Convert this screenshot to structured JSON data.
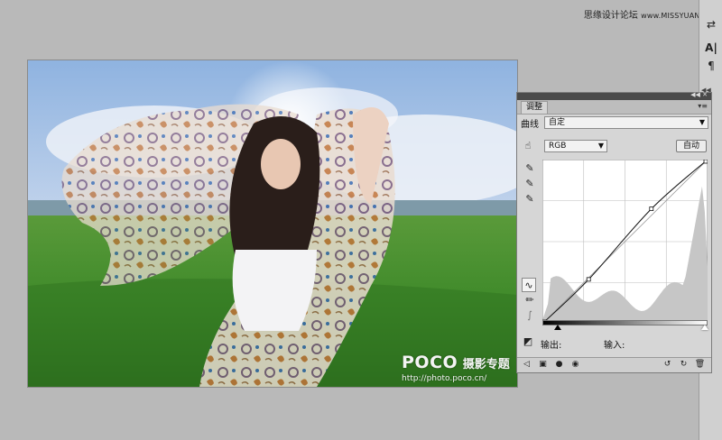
{
  "watermark": {
    "site_name": "思缘设计论坛",
    "site_url": "www.MISSYUAN.com"
  },
  "photo": {
    "brand": "POCO",
    "tagline": "摄影专题",
    "url": "http://photo.poco.cn/"
  },
  "panel": {
    "tab_label": "调整",
    "curves_label": "曲线",
    "preset_value": "自定",
    "channel_value": "RGB",
    "auto_label": "自动",
    "output_label": "输出:",
    "input_label": "输入:"
  },
  "curve": {
    "control_points": [
      [
        0,
        0
      ],
      [
        0.28,
        0.27
      ],
      [
        0.66,
        0.7
      ],
      [
        1,
        1
      ]
    ],
    "black_point": 0.08,
    "white_point": 1.0
  },
  "colors": {
    "app_bg": "#b9b9b9",
    "panel_bg": "#d6d6d6",
    "grass": "#3f8a2a",
    "sky": "#a9c3e4"
  },
  "icons": {
    "tool_strip": [
      "text-tool-icon",
      "paragraph-icon",
      "toggle-icon"
    ],
    "panel_tools": [
      "hand-target-icon",
      "black-eyedropper-icon",
      "gray-eyedropper-icon",
      "white-eyedropper-icon",
      "curve-edit-icon",
      "pencil-icon",
      "smooth-icon"
    ],
    "footer": [
      "back-icon",
      "clip-icon",
      "eye-icon",
      "visibility-icon",
      "reset-icon",
      "delete-icon"
    ]
  }
}
